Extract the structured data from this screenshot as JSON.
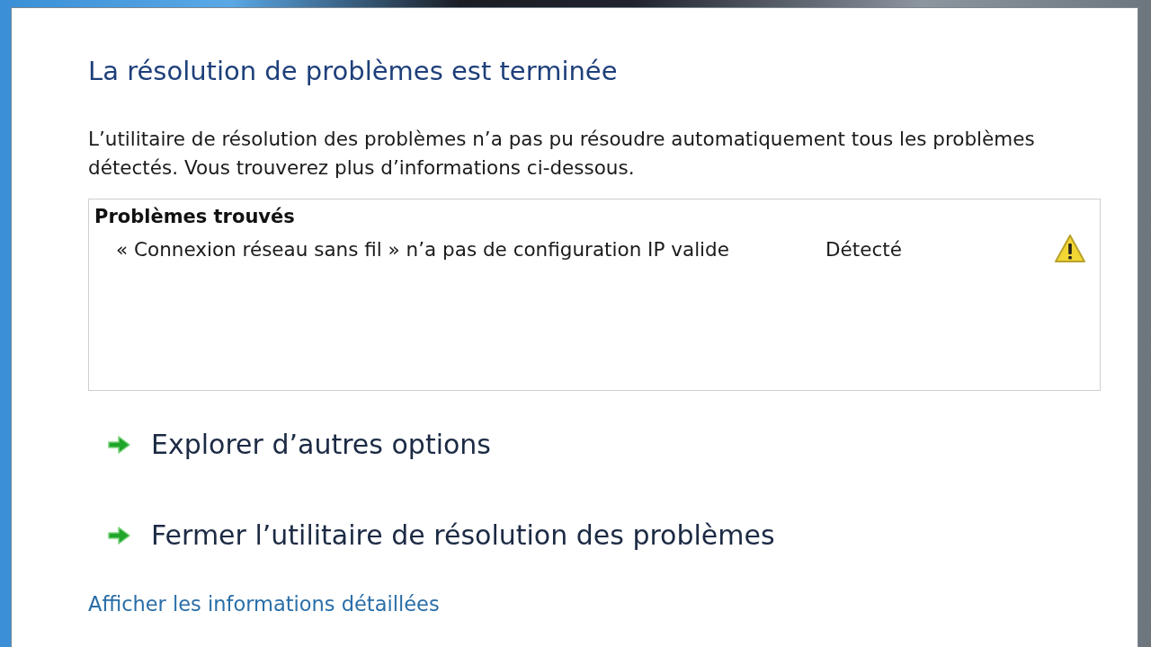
{
  "title": "La résolution de problèmes est terminée",
  "description": "L’utilitaire de résolution des problèmes n’a pas pu résoudre automatiquement tous les problèmes détectés. Vous trouverez plus d’informations ci-dessous.",
  "problems": {
    "heading": "Problèmes trouvés",
    "items": [
      {
        "text": "« Connexion réseau sans fil » n’a pas de configuration IP valide",
        "status": "Détecté",
        "kind": "warning"
      }
    ]
  },
  "options": [
    {
      "label": "Explorer d’autres options"
    },
    {
      "label": "Fermer l’utilitaire de résolution des problèmes"
    }
  ],
  "details_link": "Afficher les informations détaillées"
}
